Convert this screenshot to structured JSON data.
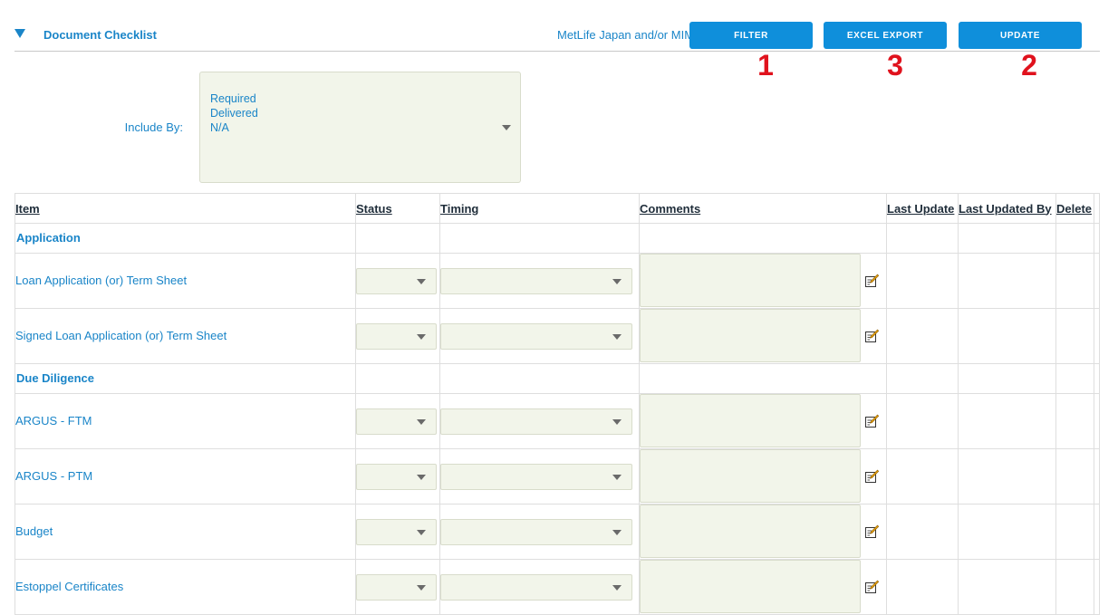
{
  "header": {
    "section_title": "Document Checklist",
    "entity_label": "MetLife Japan and/or MIM",
    "buttons": {
      "filter": "FILTER",
      "excel_export": "EXCEL EXPORT",
      "update": "UPDATE"
    },
    "markers": {
      "filter": "1",
      "excel_export": "3",
      "update": "2"
    }
  },
  "filter": {
    "include_by_label": "Include By:",
    "options": [
      "Required",
      "Delivered",
      "N/A"
    ]
  },
  "table": {
    "columns": {
      "item": "Item",
      "status": "Status",
      "timing": "Timing",
      "comments": "Comments",
      "last_update": "Last Update",
      "last_updated_by": "Last Updated By",
      "delete": "Delete"
    },
    "groups": [
      {
        "name": "Application",
        "items": [
          "Loan Application (or) Term Sheet",
          "Signed Loan Application (or) Term Sheet"
        ]
      },
      {
        "name": "Due Diligence",
        "items": [
          "ARGUS - FTM",
          "ARGUS - PTM",
          "Budget",
          "Estoppel Certificates"
        ]
      }
    ]
  },
  "icons": {
    "collapse": "triangle-down-icon",
    "edit": "edit-note-icon",
    "dropdown": "caret-down-icon"
  },
  "colors": {
    "link": "#1a85c8",
    "button": "#0f8fdb",
    "marker": "#e0121d",
    "field_bg": "#f2f5ea",
    "header_text": "#1f2d3a"
  }
}
